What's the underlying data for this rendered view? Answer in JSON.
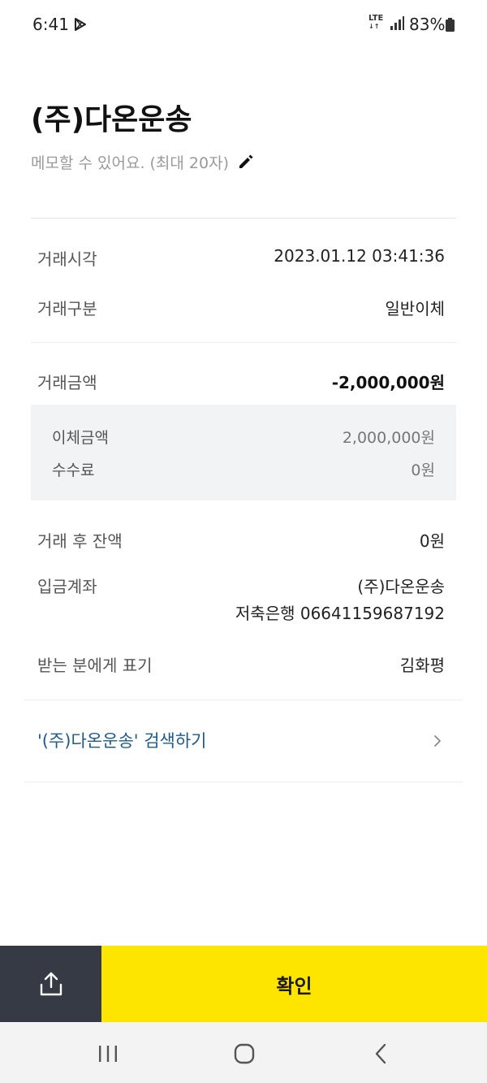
{
  "status_bar": {
    "time": "6:41",
    "network": "LTE",
    "battery": "83%"
  },
  "header": {
    "title": "(주)다온운송",
    "memo_placeholder": "메모할 수 있어요. (최대 20자)"
  },
  "details": {
    "time_label": "거래시각",
    "time_value": "2023.01.12 03:41:36",
    "type_label": "거래구분",
    "type_value": "일반이체",
    "amount_label": "거래금액",
    "amount_value": "-2,000,000원",
    "transfer_label": "이체금액",
    "transfer_value": "2,000,000원",
    "fee_label": "수수료",
    "fee_value": "0원",
    "balance_label": "거래 후 잔액",
    "balance_value": "0원",
    "account_label": "입금계좌",
    "account_name": "(주)다온운송",
    "account_number": "저축은행 06641159687192",
    "recipient_label": "받는 분에게 표기",
    "recipient_value": "김화평"
  },
  "search": {
    "label": "'(주)다온운송' 검색하기"
  },
  "actions": {
    "confirm_label": "확인"
  },
  "colors": {
    "accent_yellow": "#fee500",
    "share_button_bg": "#363a45",
    "link_blue": "#1e5a8c",
    "breakdown_bg": "#f1f3f4"
  }
}
